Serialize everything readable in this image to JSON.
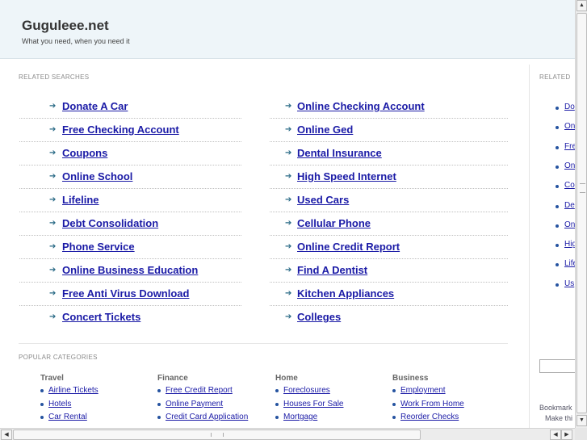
{
  "header": {
    "title": "Guguleee.net",
    "tagline": "What you need, when you need it"
  },
  "related_searches": {
    "heading": "RELATED SEARCHES",
    "left": [
      "Donate A Car",
      "Free Checking Account",
      "Coupons",
      "Online School",
      "Lifeline",
      "Debt Consolidation",
      "Phone Service",
      "Online Business Education",
      "Free Anti Virus Download",
      "Concert Tickets"
    ],
    "right": [
      "Online Checking Account",
      "Online Ged",
      "Dental Insurance",
      "High Speed Internet",
      "Used Cars",
      "Cellular Phone",
      "Online Credit Report",
      "Find A Dentist",
      "Kitchen Appliances",
      "Colleges"
    ]
  },
  "popular_categories": {
    "heading": "POPULAR CATEGORIES",
    "columns": [
      {
        "title": "Travel",
        "items": [
          "Airline Tickets",
          "Hotels",
          "Car Rental"
        ]
      },
      {
        "title": "Finance",
        "items": [
          "Free Credit Report",
          "Online Payment",
          "Credit Card Application"
        ]
      },
      {
        "title": "Home",
        "items": [
          "Foreclosures",
          "Houses For Sale",
          "Mortgage"
        ]
      },
      {
        "title": "Business",
        "items": [
          "Employment",
          "Work From Home",
          "Reorder Checks"
        ]
      }
    ]
  },
  "sidebar": {
    "heading": "RELATED",
    "items": [
      "Do",
      "On",
      "Fre",
      "On",
      "Co",
      "De",
      "On",
      "Hig",
      "Life",
      "Us"
    ],
    "bookmark": "Bookmark",
    "make_this": "Make thi"
  },
  "scrollbars": {
    "up_arrow": "▲",
    "down_arrow": "▼",
    "left_arrow": "◀",
    "right_arrow": "▶"
  }
}
